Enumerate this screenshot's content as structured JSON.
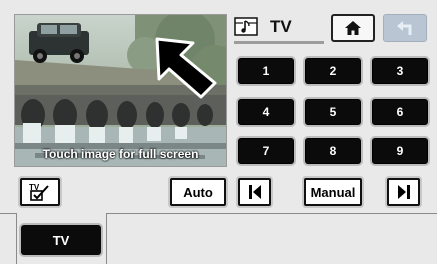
{
  "header": {
    "source_icon": "music-note-screen-icon",
    "title": "TV",
    "home_icon": "home-icon",
    "back_icon": "back-arrow-icon"
  },
  "preview": {
    "caption": "Touch image for full screen",
    "overlay_icon": "fullscreen-arrow-icon"
  },
  "keypad": {
    "keys": [
      "1",
      "2",
      "3",
      "4",
      "5",
      "6",
      "7",
      "8",
      "9"
    ]
  },
  "controls": {
    "tv_menu_icon": "tv-checklist-icon",
    "auto_label": "Auto",
    "prev_icon": "skip-previous-icon",
    "manual_label": "Manual",
    "next_icon": "skip-next-icon"
  },
  "tabs": [
    {
      "label": "TV"
    }
  ],
  "colors": {
    "background": "#e9e9e9",
    "key_fill": "#0b0b0b",
    "back_button": "#b9c5d3"
  }
}
